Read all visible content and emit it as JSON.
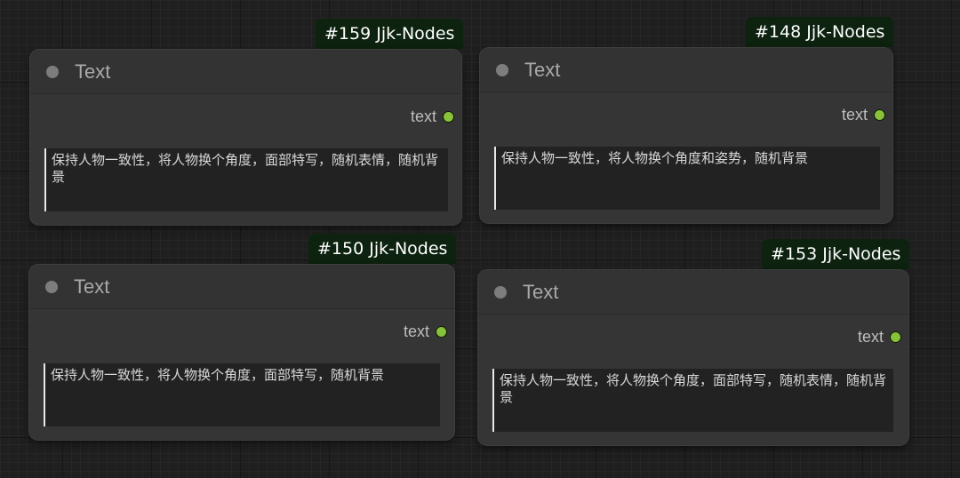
{
  "nodes": [
    {
      "badge": "#159 Jjk-Nodes",
      "title": "Text",
      "output_label": "text",
      "text_value": "保持人物一致性，将人物换个角度，面部特写，随机表情，随机背景"
    },
    {
      "badge": "#148 Jjk-Nodes",
      "title": "Text",
      "output_label": "text",
      "text_value": "保持人物一致性，将人物换个角度和姿势，随机背景"
    },
    {
      "badge": "#150 Jjk-Nodes",
      "title": "Text",
      "output_label": "text",
      "text_value": "保持人物一致性，将人物换个角度，面部特写，随机背景"
    },
    {
      "badge": "#153 Jjk-Nodes",
      "title": "Text",
      "output_label": "text",
      "text_value": "保持人物一致性，将人物换个角度，面部特写，随机表情，随机背景"
    }
  ],
  "colors": {
    "badge_bg": "#0d220f",
    "output_slot": "#88c13a",
    "node_bg": "#353535"
  }
}
